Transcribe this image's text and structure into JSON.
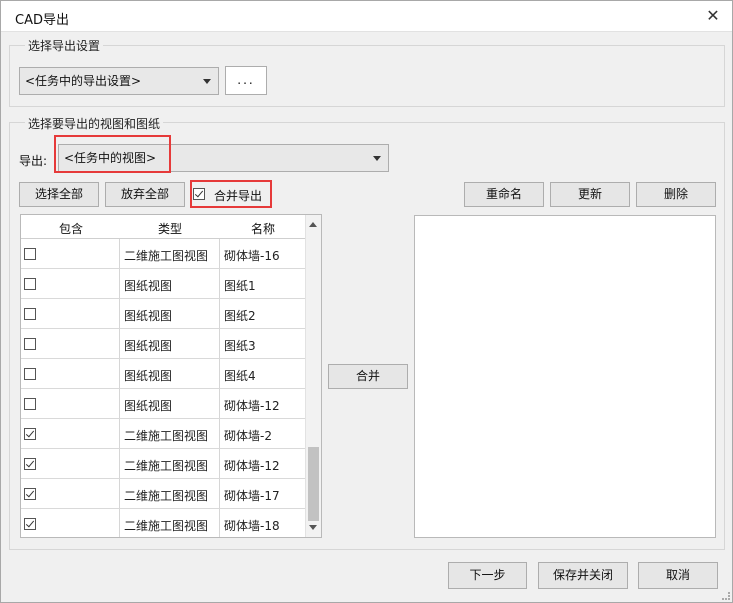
{
  "window": {
    "title": "CAD导出",
    "close_icon": "close-icon"
  },
  "settings_group": {
    "title": "选择导出设置",
    "combo_value": "<任务中的导出设置>",
    "ellipsis_label": "..."
  },
  "views_group": {
    "title": "选择要导出的视图和图纸",
    "export_label": "导出:",
    "export_combo_value": "<任务中的视图>",
    "select_all": "选择全部",
    "deselect_all": "放弃全部",
    "merge_export_label": "合并导出",
    "merge_export_checked": true,
    "rename": "重命名",
    "update": "更新",
    "delete": "删除",
    "merge_button": "合并"
  },
  "table": {
    "headers": {
      "include": "包含",
      "type": "类型",
      "name": "名称"
    },
    "rows": [
      {
        "checked": false,
        "type": "二维施工图视图",
        "name": "砌体墙-16"
      },
      {
        "checked": false,
        "type": "图纸视图",
        "name": "图纸1"
      },
      {
        "checked": false,
        "type": "图纸视图",
        "name": "图纸2"
      },
      {
        "checked": false,
        "type": "图纸视图",
        "name": "图纸3"
      },
      {
        "checked": false,
        "type": "图纸视图",
        "name": "图纸4"
      },
      {
        "checked": false,
        "type": "图纸视图",
        "name": "砌体墙-12"
      },
      {
        "checked": true,
        "type": "二维施工图视图",
        "name": "砌体墙-2"
      },
      {
        "checked": true,
        "type": "二维施工图视图",
        "name": "砌体墙-12"
      },
      {
        "checked": true,
        "type": "二维施工图视图",
        "name": "砌体墙-17"
      },
      {
        "checked": true,
        "type": "二维施工图视图",
        "name": "砌体墙-18"
      }
    ]
  },
  "footer": {
    "next": "下一步",
    "save_close": "保存并关闭",
    "cancel": "取消"
  },
  "colors": {
    "highlight_box": "#e63a3a",
    "window_bg": "#f0f0f0"
  }
}
